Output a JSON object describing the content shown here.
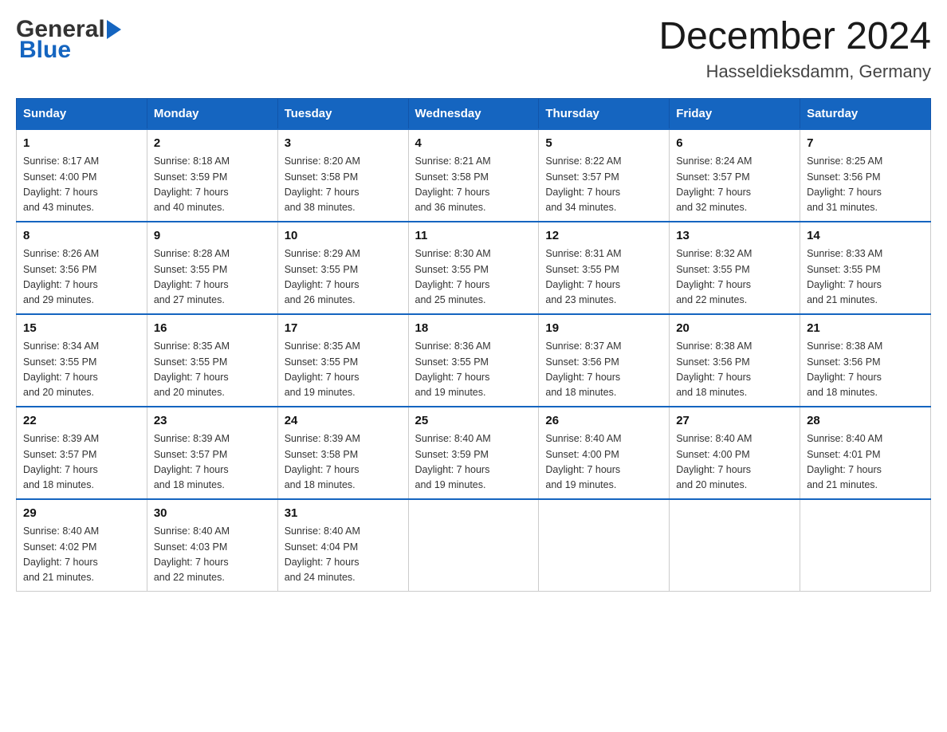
{
  "header": {
    "logo_general": "General",
    "logo_blue": "Blue",
    "month_title": "December 2024",
    "location": "Hasseldieksdamm, Germany"
  },
  "calendar": {
    "days_of_week": [
      "Sunday",
      "Monday",
      "Tuesday",
      "Wednesday",
      "Thursday",
      "Friday",
      "Saturday"
    ],
    "weeks": [
      [
        {
          "day": "1",
          "sunrise": "Sunrise: 8:17 AM",
          "sunset": "Sunset: 4:00 PM",
          "daylight": "Daylight: 7 hours",
          "minutes": "and 43 minutes."
        },
        {
          "day": "2",
          "sunrise": "Sunrise: 8:18 AM",
          "sunset": "Sunset: 3:59 PM",
          "daylight": "Daylight: 7 hours",
          "minutes": "and 40 minutes."
        },
        {
          "day": "3",
          "sunrise": "Sunrise: 8:20 AM",
          "sunset": "Sunset: 3:58 PM",
          "daylight": "Daylight: 7 hours",
          "minutes": "and 38 minutes."
        },
        {
          "day": "4",
          "sunrise": "Sunrise: 8:21 AM",
          "sunset": "Sunset: 3:58 PM",
          "daylight": "Daylight: 7 hours",
          "minutes": "and 36 minutes."
        },
        {
          "day": "5",
          "sunrise": "Sunrise: 8:22 AM",
          "sunset": "Sunset: 3:57 PM",
          "daylight": "Daylight: 7 hours",
          "minutes": "and 34 minutes."
        },
        {
          "day": "6",
          "sunrise": "Sunrise: 8:24 AM",
          "sunset": "Sunset: 3:57 PM",
          "daylight": "Daylight: 7 hours",
          "minutes": "and 32 minutes."
        },
        {
          "day": "7",
          "sunrise": "Sunrise: 8:25 AM",
          "sunset": "Sunset: 3:56 PM",
          "daylight": "Daylight: 7 hours",
          "minutes": "and 31 minutes."
        }
      ],
      [
        {
          "day": "8",
          "sunrise": "Sunrise: 8:26 AM",
          "sunset": "Sunset: 3:56 PM",
          "daylight": "Daylight: 7 hours",
          "minutes": "and 29 minutes."
        },
        {
          "day": "9",
          "sunrise": "Sunrise: 8:28 AM",
          "sunset": "Sunset: 3:55 PM",
          "daylight": "Daylight: 7 hours",
          "minutes": "and 27 minutes."
        },
        {
          "day": "10",
          "sunrise": "Sunrise: 8:29 AM",
          "sunset": "Sunset: 3:55 PM",
          "daylight": "Daylight: 7 hours",
          "minutes": "and 26 minutes."
        },
        {
          "day": "11",
          "sunrise": "Sunrise: 8:30 AM",
          "sunset": "Sunset: 3:55 PM",
          "daylight": "Daylight: 7 hours",
          "minutes": "and 25 minutes."
        },
        {
          "day": "12",
          "sunrise": "Sunrise: 8:31 AM",
          "sunset": "Sunset: 3:55 PM",
          "daylight": "Daylight: 7 hours",
          "minutes": "and 23 minutes."
        },
        {
          "day": "13",
          "sunrise": "Sunrise: 8:32 AM",
          "sunset": "Sunset: 3:55 PM",
          "daylight": "Daylight: 7 hours",
          "minutes": "and 22 minutes."
        },
        {
          "day": "14",
          "sunrise": "Sunrise: 8:33 AM",
          "sunset": "Sunset: 3:55 PM",
          "daylight": "Daylight: 7 hours",
          "minutes": "and 21 minutes."
        }
      ],
      [
        {
          "day": "15",
          "sunrise": "Sunrise: 8:34 AM",
          "sunset": "Sunset: 3:55 PM",
          "daylight": "Daylight: 7 hours",
          "minutes": "and 20 minutes."
        },
        {
          "day": "16",
          "sunrise": "Sunrise: 8:35 AM",
          "sunset": "Sunset: 3:55 PM",
          "daylight": "Daylight: 7 hours",
          "minutes": "and 20 minutes."
        },
        {
          "day": "17",
          "sunrise": "Sunrise: 8:35 AM",
          "sunset": "Sunset: 3:55 PM",
          "daylight": "Daylight: 7 hours",
          "minutes": "and 19 minutes."
        },
        {
          "day": "18",
          "sunrise": "Sunrise: 8:36 AM",
          "sunset": "Sunset: 3:55 PM",
          "daylight": "Daylight: 7 hours",
          "minutes": "and 19 minutes."
        },
        {
          "day": "19",
          "sunrise": "Sunrise: 8:37 AM",
          "sunset": "Sunset: 3:56 PM",
          "daylight": "Daylight: 7 hours",
          "minutes": "and 18 minutes."
        },
        {
          "day": "20",
          "sunrise": "Sunrise: 8:38 AM",
          "sunset": "Sunset: 3:56 PM",
          "daylight": "Daylight: 7 hours",
          "minutes": "and 18 minutes."
        },
        {
          "day": "21",
          "sunrise": "Sunrise: 8:38 AM",
          "sunset": "Sunset: 3:56 PM",
          "daylight": "Daylight: 7 hours",
          "minutes": "and 18 minutes."
        }
      ],
      [
        {
          "day": "22",
          "sunrise": "Sunrise: 8:39 AM",
          "sunset": "Sunset: 3:57 PM",
          "daylight": "Daylight: 7 hours",
          "minutes": "and 18 minutes."
        },
        {
          "day": "23",
          "sunrise": "Sunrise: 8:39 AM",
          "sunset": "Sunset: 3:57 PM",
          "daylight": "Daylight: 7 hours",
          "minutes": "and 18 minutes."
        },
        {
          "day": "24",
          "sunrise": "Sunrise: 8:39 AM",
          "sunset": "Sunset: 3:58 PM",
          "daylight": "Daylight: 7 hours",
          "minutes": "and 18 minutes."
        },
        {
          "day": "25",
          "sunrise": "Sunrise: 8:40 AM",
          "sunset": "Sunset: 3:59 PM",
          "daylight": "Daylight: 7 hours",
          "minutes": "and 19 minutes."
        },
        {
          "day": "26",
          "sunrise": "Sunrise: 8:40 AM",
          "sunset": "Sunset: 4:00 PM",
          "daylight": "Daylight: 7 hours",
          "minutes": "and 19 minutes."
        },
        {
          "day": "27",
          "sunrise": "Sunrise: 8:40 AM",
          "sunset": "Sunset: 4:00 PM",
          "daylight": "Daylight: 7 hours",
          "minutes": "and 20 minutes."
        },
        {
          "day": "28",
          "sunrise": "Sunrise: 8:40 AM",
          "sunset": "Sunset: 4:01 PM",
          "daylight": "Daylight: 7 hours",
          "minutes": "and 21 minutes."
        }
      ],
      [
        {
          "day": "29",
          "sunrise": "Sunrise: 8:40 AM",
          "sunset": "Sunset: 4:02 PM",
          "daylight": "Daylight: 7 hours",
          "minutes": "and 21 minutes."
        },
        {
          "day": "30",
          "sunrise": "Sunrise: 8:40 AM",
          "sunset": "Sunset: 4:03 PM",
          "daylight": "Daylight: 7 hours",
          "minutes": "and 22 minutes."
        },
        {
          "day": "31",
          "sunrise": "Sunrise: 8:40 AM",
          "sunset": "Sunset: 4:04 PM",
          "daylight": "Daylight: 7 hours",
          "minutes": "and 24 minutes."
        },
        null,
        null,
        null,
        null
      ]
    ]
  }
}
